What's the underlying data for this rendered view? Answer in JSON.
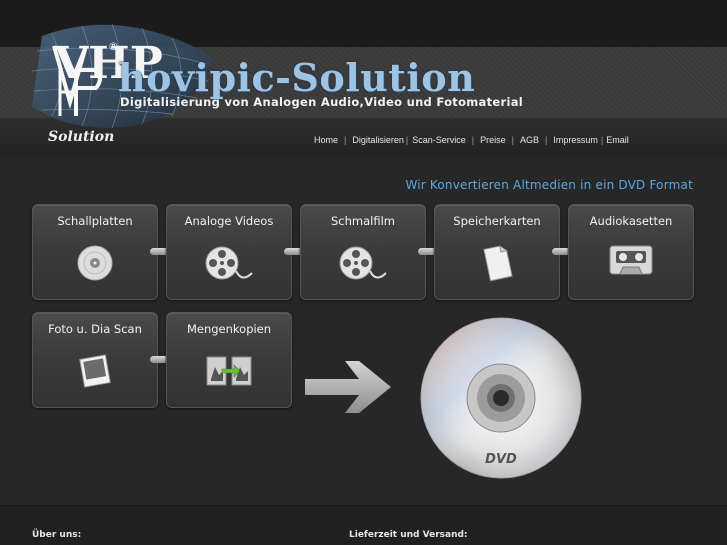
{
  "header": {
    "logo_letters": "VHP",
    "logo_reg_mark": "®",
    "title": "hovipic-Solution",
    "subtitle": "Digitalisierung von Analogen Audio,Video und Fotomaterial",
    "logo_solution": "Solution"
  },
  "nav": {
    "items": [
      {
        "label": "Home"
      },
      {
        "label": "Digitalisieren"
      },
      {
        "label": "Scan-Service"
      },
      {
        "label": "Preise"
      },
      {
        "label": "AGB"
      },
      {
        "label": "Impressum"
      },
      {
        "label": "Email"
      }
    ],
    "separator": "|"
  },
  "tagline": "Wir Konvertieren Altmedien in ein DVD Format",
  "tiles": [
    {
      "label": "Schallplatten",
      "icon": "vinyl-record-icon"
    },
    {
      "label": "Analoge Videos",
      "icon": "film-reel-icon"
    },
    {
      "label": "Schmalfilm",
      "icon": "film-reel-icon"
    },
    {
      "label": "Speicherkarten",
      "icon": "memory-card-icon"
    },
    {
      "label": "Audiokasetten",
      "icon": "cassette-icon"
    },
    {
      "label": "Foto u. Dia Scan",
      "icon": "photo-icon"
    },
    {
      "label": "Mengenkopien",
      "icon": "copy-icon"
    }
  ],
  "result": {
    "arrow_icon": "arrow-right-icon",
    "disc_label": "DVD"
  },
  "footer": {
    "about_heading": "Über uns:",
    "delivery_heading": "Lieferzeit und Versand:"
  },
  "colors": {
    "background": "#272727",
    "accent_blue": "#5ba8e0",
    "logo_blue": "#9fc3e3"
  }
}
